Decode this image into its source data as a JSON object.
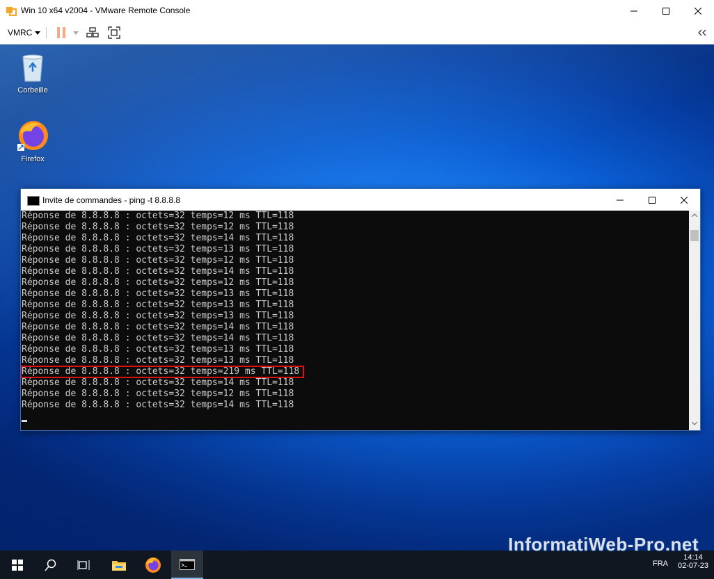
{
  "window": {
    "title": "Win 10 x64 v2004 - VMware Remote Console",
    "toolbar": {
      "vmrc_label": "VMRC"
    }
  },
  "desktop": {
    "icons": [
      {
        "label": "Corbeille",
        "icon": "recycle-bin-icon"
      },
      {
        "label": "Firefox",
        "icon": "firefox-icon"
      }
    ]
  },
  "cmd": {
    "title": "Invite de commandes - ping  -t 8.8.8.8",
    "lines": [
      "Réponse de 8.8.8.8 : octets=32 temps=12 ms TTL=118",
      "Réponse de 8.8.8.8 : octets=32 temps=12 ms TTL=118",
      "Réponse de 8.8.8.8 : octets=32 temps=14 ms TTL=118",
      "Réponse de 8.8.8.8 : octets=32 temps=13 ms TTL=118",
      "Réponse de 8.8.8.8 : octets=32 temps=12 ms TTL=118",
      "Réponse de 8.8.8.8 : octets=32 temps=14 ms TTL=118",
      "Réponse de 8.8.8.8 : octets=32 temps=12 ms TTL=118",
      "Réponse de 8.8.8.8 : octets=32 temps=13 ms TTL=118",
      "Réponse de 8.8.8.8 : octets=32 temps=13 ms TTL=118",
      "Réponse de 8.8.8.8 : octets=32 temps=13 ms TTL=118",
      "Réponse de 8.8.8.8 : octets=32 temps=14 ms TTL=118",
      "Réponse de 8.8.8.8 : octets=32 temps=14 ms TTL=118",
      "Réponse de 8.8.8.8 : octets=32 temps=13 ms TTL=118",
      "Réponse de 8.8.8.8 : octets=32 temps=13 ms TTL=118",
      "Réponse de 8.8.8.8 : octets=32 temps=219 ms TTL=118",
      "Réponse de 8.8.8.8 : octets=32 temps=14 ms TTL=118",
      "Réponse de 8.8.8.8 : octets=32 temps=12 ms TTL=118",
      "Réponse de 8.8.8.8 : octets=32 temps=14 ms TTL=118"
    ],
    "highlight_color": "#e01010"
  },
  "taskbar": {
    "lang": "FRA",
    "time": "14:14",
    "date": "02-07-23"
  },
  "watermark": "InformatiWeb-Pro.net"
}
